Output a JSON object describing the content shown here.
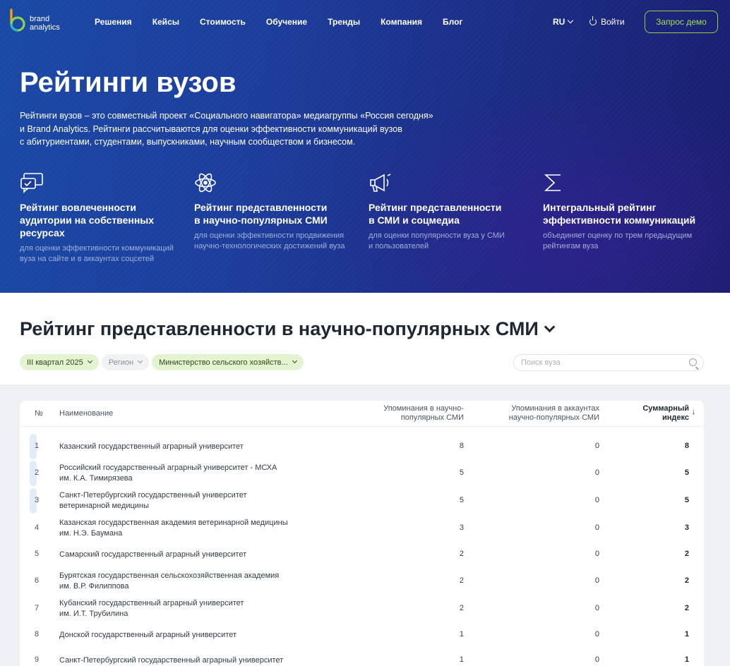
{
  "brand": {
    "name_line1": "brand",
    "name_line2": "analytics",
    "accent": "#8fd14f"
  },
  "nav": {
    "items": [
      "Решения",
      "Кейсы",
      "Стоимость",
      "Обучение",
      "Тренды",
      "Компания",
      "Блог"
    ]
  },
  "header": {
    "lang": "RU",
    "login": "Войти",
    "demo": "Запрос демо"
  },
  "hero": {
    "title": "Рейтинги вузов",
    "desc": [
      "Рейтинги вузов – это совместный проект «Социального навигатора» медиагруппы «Россия сегодня»",
      "и Brand Analytics. Рейтинги рассчитываются для оценки эффективности коммуникаций вузов",
      "с абитуриентами, студентами, выпускниками, научным сообществом и бизнесом."
    ],
    "cards": [
      {
        "icon": "chat-bubbles-icon",
        "title": [
          "Рейтинг вовлеченности",
          "аудитории на собственных",
          "ресурсах"
        ],
        "desc": [
          "для оценки эффективности коммуникаций",
          "вуза на сайте и в аккаунтах соцсетей"
        ]
      },
      {
        "icon": "atom-icon",
        "title": [
          "Рейтинг представленности",
          "в научно-популярных СМИ"
        ],
        "desc": [
          "для оценки эффективности продвижения",
          "научно-технологических достижений вуза"
        ]
      },
      {
        "icon": "megaphone-icon",
        "title": [
          "Рейтинг представленности",
          "в СМИ и соцмедиа"
        ],
        "desc": [
          "для оценки популярности вуза у СМИ",
          "и пользователей"
        ]
      },
      {
        "icon": "sigma-icon",
        "title": [
          "Интегральный рейтинг",
          "эффективности коммуникаций"
        ],
        "desc": [
          "объединяет оценку по трем предыдущим",
          "рейтингам вуза"
        ]
      }
    ]
  },
  "section": {
    "title": "Рейтинг представленности в научно-популярных СМИ",
    "filters": {
      "period": "III квартал 2025",
      "region": "Регион",
      "ministry": "Министерство сельского хозяйств..."
    },
    "search_placeholder": "Поиск вуза"
  },
  "table": {
    "headers": {
      "num": "№",
      "name": "Наименование",
      "col1": [
        "Упоминания в научно-",
        "популярных СМИ"
      ],
      "col2": [
        "Упоминания в аккаунтах",
        "научно-популярных СМИ"
      ],
      "col3": [
        "Суммарный",
        "индекс"
      ]
    },
    "rows": [
      {
        "num": "1",
        "name": [
          "Казанский государственный аграрный университет"
        ],
        "v1": "8",
        "v2": "0",
        "v3": "8"
      },
      {
        "num": "2",
        "name": [
          "Российский государственный аграрный университет - МСХА",
          "им. К.А. Тимирязева"
        ],
        "v1": "5",
        "v2": "0",
        "v3": "5"
      },
      {
        "num": "3",
        "name": [
          "Санкт-Петербургский государственный университет",
          "ветеринарной медицины"
        ],
        "v1": "5",
        "v2": "0",
        "v3": "5"
      },
      {
        "num": "4",
        "name": [
          "Казанская государственная академия ветеринарной медицины",
          "им. Н.Э. Баумана"
        ],
        "v1": "3",
        "v2": "0",
        "v3": "3"
      },
      {
        "num": "5",
        "name": [
          "Самарский государственный аграрный университет"
        ],
        "v1": "2",
        "v2": "0",
        "v3": "2"
      },
      {
        "num": "6",
        "name": [
          "Бурятская государственная сельскохозяйственная академия",
          "им. В.Р. Филиппова"
        ],
        "v1": "2",
        "v2": "0",
        "v3": "2"
      },
      {
        "num": "7",
        "name": [
          "Кубанский государственный аграрный университет",
          "им. И.Т. Трубилина"
        ],
        "v1": "2",
        "v2": "0",
        "v3": "2"
      },
      {
        "num": "8",
        "name": [
          "Донской государственный аграрный университет"
        ],
        "v1": "1",
        "v2": "0",
        "v3": "1"
      },
      {
        "num": "9",
        "name": [
          "Санкт-Петербургский государственный аграрный университет"
        ],
        "v1": "1",
        "v2": "0",
        "v3": "1"
      }
    ]
  }
}
